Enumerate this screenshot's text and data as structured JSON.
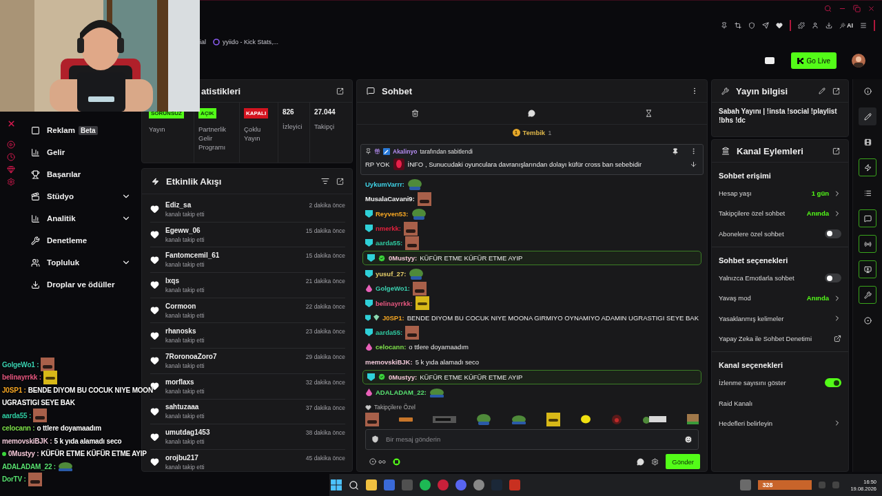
{
  "browser": {
    "bookmarks": [
      "ial",
      "yyiido - Kick Stats,..."
    ],
    "ai_label": "AI"
  },
  "header": {
    "go_live": "Go Live"
  },
  "sidebar": {
    "items": [
      {
        "label": "Reklam",
        "badge": "Beta",
        "expandable": false
      },
      {
        "label": "Gelir",
        "expandable": false
      },
      {
        "label": "Başarılar",
        "expandable": false
      },
      {
        "label": "Stüdyo",
        "expandable": true
      },
      {
        "label": "Analitik",
        "expandable": true
      },
      {
        "label": "Denetleme",
        "expandable": false
      },
      {
        "label": "Topluluk",
        "expandable": true
      },
      {
        "label": "Droplar ve ödüller",
        "expandable": false
      }
    ]
  },
  "stats": {
    "title": "atistikleri",
    "items": [
      {
        "kind": "status-ok",
        "status": "SORUNSUZ",
        "label": "Yayın"
      },
      {
        "kind": "status-ok",
        "status": "AÇIK",
        "label": "Partnerlik Gelir Programı"
      },
      {
        "kind": "status-off",
        "status": "KAPALI",
        "label": "Çoklu Yayın"
      },
      {
        "kind": "count",
        "value": "826",
        "label": "İzleyici"
      },
      {
        "kind": "count",
        "value": "27.044",
        "label": "Takipçi"
      }
    ]
  },
  "activity": {
    "title": "Etkinlik Akışı",
    "events": [
      {
        "user": "Ediz_sa",
        "action": "kanalı takip etti",
        "time": "2 dakika önce"
      },
      {
        "user": "Egeww_06",
        "action": "kanalı takip etti",
        "time": "15 dakika önce"
      },
      {
        "user": "Fantomcemil_61",
        "action": "kanalı takip etti",
        "time": "15 dakika önce"
      },
      {
        "user": "lxqs",
        "action": "kanalı takip etti",
        "time": "21 dakika önce"
      },
      {
        "user": "Cormoon",
        "action": "kanalı takip etti",
        "time": "22 dakika önce"
      },
      {
        "user": "rhanosks",
        "action": "kanalı takip etti",
        "time": "23 dakika önce"
      },
      {
        "user": "7RoronoaZoro7",
        "action": "kanalı takip etti",
        "time": "29 dakika önce"
      },
      {
        "user": "morflaxs",
        "action": "kanalı takip etti",
        "time": "32 dakika önce"
      },
      {
        "user": "sahtuzaaa",
        "action": "kanalı takip etti",
        "time": "37 dakika önce"
      },
      {
        "user": "umutdag1453",
        "action": "kanalı takip etti",
        "time": "38 dakika önce"
      },
      {
        "user": "orojbu217",
        "action": "kanalı takip etti",
        "time": "45 dakika önce"
      }
    ]
  },
  "chat": {
    "title": "Sohbet",
    "leader": {
      "name": "Tembik",
      "rank": "1",
      "count": "1"
    },
    "pinned": {
      "by": "Akalinyo",
      "by_suffix": "tarafından sabitlendi",
      "prefix": "RP YOK",
      "text": "İNFO , Sunucudaki oyunculara davranışlarından dolayı küfür cross ban sebebidir"
    },
    "messages": [
      {
        "user": "UykumVarrr:",
        "color": "#3fd4e8",
        "emote": {
          "kind": "pepe"
        }
      },
      {
        "user": "MusalaCavani9:",
        "color": "#f2f2f2",
        "emote": {
          "kind": "face"
        }
      },
      {
        "user": "Reyven53:",
        "color": "#f5a623",
        "badge": {
          "kind": "sub"
        },
        "emote": {
          "kind": "pepe"
        }
      },
      {
        "user": "nmerkk:",
        "color": "#e0203c",
        "badge": {
          "kind": "sub"
        },
        "emote": {
          "kind": "face"
        }
      },
      {
        "user": "aarda55:",
        "color": "#2fc9a0",
        "badge": {
          "kind": "sub"
        },
        "emote": {
          "kind": "face"
        }
      },
      {
        "user": "0Mustyy:",
        "color": "#f4c6d6",
        "badge": {
          "kind": "sub"
        },
        "verified": true,
        "highlighted": true,
        "text": "KÜFÜR ETME KÜFÜR ETME AYIP"
      },
      {
        "user": "yusuf_27:",
        "color": "#e8d06a",
        "badge": {
          "kind": "sub"
        },
        "emote": {
          "kind": "pepe"
        }
      },
      {
        "user": "GolgeWo1:",
        "color": "#3ad0b0",
        "badge": {
          "kind": "drop"
        },
        "emote": {
          "kind": "face"
        }
      },
      {
        "user": "belinayrrkk:",
        "color": "#e6577f",
        "badge": {
          "kind": "sub"
        },
        "emote": {
          "kind": "yellow"
        }
      },
      {
        "user": "J0SP1:",
        "color": "#f5a623",
        "badge": {
          "kind": "sub"
        },
        "crystal": true,
        "text": "BENDE DIYOM BU COCUK NIYE MOONA GIRMIYO OYNAMIYO ADAMIN UGRASTIGI SEYE BAK"
      },
      {
        "user": "aarda55:",
        "color": "#2fc9a0",
        "badge": {
          "kind": "sub"
        },
        "emote": {
          "kind": "face"
        }
      },
      {
        "user": "celocann:",
        "color": "#7ee04a",
        "badge": {
          "kind": "drop"
        },
        "text": "o ttlere doyamaadım"
      },
      {
        "user": "memovskiBJK:",
        "color": "#f0c8d8",
        "text": "5 k yıda alamadı seco"
      },
      {
        "user": "0Mustyy:",
        "color": "#f4c6d6",
        "badge": {
          "kind": "sub"
        },
        "verified": true,
        "highlighted": true,
        "text": "KÜFÜR ETME KÜFÜR ETME AYIP"
      },
      {
        "user": "ADALADAM_22:",
        "color": "#58e070",
        "badge": {
          "kind": "drop"
        },
        "emote": {
          "kind": "frog"
        }
      }
    ],
    "emote_label": "Takipçilere Özel",
    "emotes": [
      {
        "kind": "face"
      },
      {
        "kind": "bar"
      },
      {
        "kind": "dark"
      },
      {
        "kind": "pepe"
      },
      {
        "kind": "frog"
      },
      {
        "kind": "yellow"
      },
      {
        "kind": "lemon"
      },
      {
        "kind": "red"
      },
      {
        "kind": "sign"
      },
      {
        "kind": "gg"
      }
    ],
    "input": {
      "placeholder": "Bir mesaj gönderin"
    },
    "send": "Gönder"
  },
  "stream_info": {
    "title": "Yayın bilgisi",
    "text": "Sabah Yayını | !insta !social !playlist !bhs !dc"
  },
  "channel_actions": {
    "title": "Kanal Eylemleri",
    "sections": [
      {
        "title": "Sohbet erişimi",
        "rows": [
          {
            "kind": "value",
            "label": "Hesap yaşı",
            "value": "1 gün"
          },
          {
            "kind": "value",
            "label": "Takipçilere özel sohbet",
            "value": "Anında"
          },
          {
            "kind": "toggle",
            "label": "Abonelere özel sohbet",
            "on": false
          }
        ]
      },
      {
        "title": "Sohbet seçenekleri",
        "rows": [
          {
            "kind": "toggle",
            "label": "Yalnızca Emotlarla sohbet",
            "on": false
          },
          {
            "kind": "value",
            "label": "Yavaş mod",
            "value": "Anında"
          },
          {
            "kind": "link",
            "label": "Yasaklanmış kelimeler"
          },
          {
            "kind": "external",
            "label": "Yapay Zeka ile Sohbet Denetimi"
          }
        ]
      },
      {
        "title": "Kanal seçenekleri",
        "rows": [
          {
            "kind": "toggle",
            "label": "İzlenme sayısını göster",
            "on": true
          },
          {
            "kind": "plain",
            "label": "Raid Kanalı"
          },
          {
            "kind": "link",
            "label": "Hedefleri belirleyin"
          }
        ]
      }
    ]
  },
  "rail": [
    {
      "selected": false,
      "pinned": false
    },
    {
      "selected": true,
      "pinned": false
    },
    {
      "selected": false,
      "pinned": false
    },
    {
      "selected": false,
      "pinned": true
    },
    {
      "selected": false,
      "pinned": false
    },
    {
      "selected": false,
      "pinned": true
    },
    {
      "selected": false,
      "pinned": true
    },
    {
      "selected": false,
      "pinned": true
    },
    {
      "selected": false,
      "pinned": true
    },
    {
      "selected": false,
      "pinned": false
    }
  ],
  "overlay_chat": [
    {
      "user": "GolgeWo1 :",
      "color": "#3ad0b0",
      "emote": {
        "kind": "face"
      }
    },
    {
      "user": "belinayrrkk :",
      "color": "#e6577f",
      "emote": {
        "kind": "yellow"
      }
    },
    {
      "user": "J0SP1 :",
      "color": "#f5a623",
      "text": "BENDE DIYOM BU COCUK NIYE MOON",
      "continuation": "UGRASTIGI SEYE BAK"
    },
    {
      "user": "aarda55 :",
      "color": "#2fc9a0",
      "emote": {
        "kind": "face"
      }
    },
    {
      "user": "celocann :",
      "color": "#7ee04a",
      "text": "o ttlere doyamaadım"
    },
    {
      "user": "memovskiBJK :",
      "color": "#f0c8d8",
      "text": "5 k yıda alamadı seco"
    },
    {
      "user": "0Mustyy :",
      "color": "#f4c6d6",
      "verified": true,
      "text": "KÜFÜR ETME KÜFÜR ETME AYIP"
    },
    {
      "user": "ADALADAM_22 :",
      "color": "#58e070",
      "emote": {
        "kind": "frog"
      }
    },
    {
      "user": "DorTV :",
      "color": "#58e070",
      "emote": {
        "kind": "face"
      }
    }
  ],
  "taskbar": {
    "counter": "328",
    "time": "16:50",
    "date": "19.08.2026"
  }
}
